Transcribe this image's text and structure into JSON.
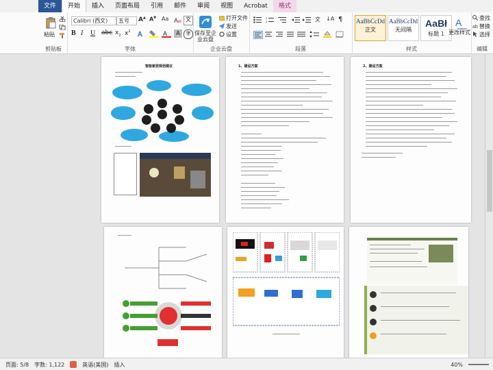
{
  "tabs": {
    "file": "文件",
    "home": "开始",
    "insert": "插入",
    "layout": "页面布局",
    "references": "引用",
    "mailings": "邮件",
    "review": "审阅",
    "view": "视图",
    "acrobat": "Acrobat",
    "format": "格式"
  },
  "ribbon": {
    "clipboard": {
      "paste": "粘贴",
      "label": "剪贴板"
    },
    "font": {
      "name": "Calibri (西文)",
      "size": "五号",
      "label": "字体"
    },
    "cloud": {
      "save_to_cloud": "保存至企业云盘",
      "open_file": "打开文件",
      "send": "发送",
      "settings": "设置",
      "label": "企业云盘"
    },
    "paragraph": {
      "label": "段落"
    },
    "styles": {
      "items": [
        {
          "sample": "AaBbCcDd",
          "name": "正文"
        },
        {
          "sample": "AaBbCcDd",
          "name": "无间隔"
        },
        {
          "sample": "AaBł",
          "name": "标题 1"
        }
      ],
      "change": "更改样式",
      "label": "样式"
    },
    "editing": {
      "find": "查找",
      "replace": "替换",
      "select": "选择",
      "label": "编辑"
    }
  },
  "pages": {
    "p1_title": "智能家居规划建议",
    "p2_title": "1、建设方案",
    "p3_title": "2、建设方案"
  },
  "status": {
    "page": "页面: 5/8",
    "words": "字数: 1,122",
    "language": "英语(美国)",
    "mode": "插入",
    "zoom": "40%"
  }
}
